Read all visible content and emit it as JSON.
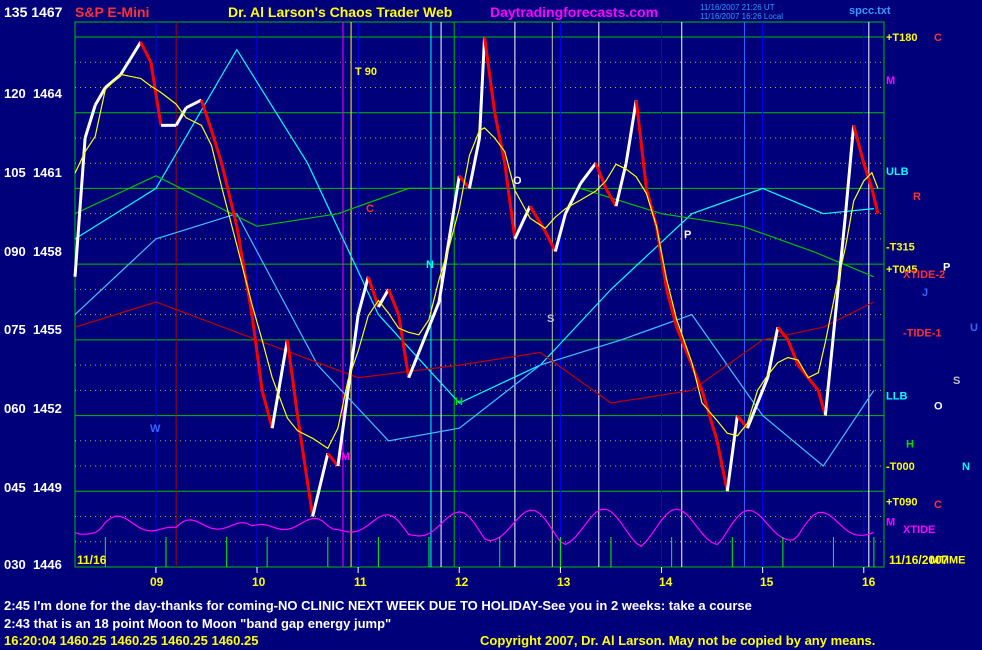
{
  "header": {
    "instrument": "S&P E-Mini",
    "title": "Dr. Al Larson's Chaos Trader Web",
    "site": "Daytradingforecasts.com",
    "time_utc": "11/16/2007 21:26 UT",
    "time_local": "11/16/2007 16:26 Local",
    "file": "spcc.txt"
  },
  "chart_data": {
    "type": "line",
    "title": "S&P E-Mini",
    "y_axis": {
      "ticks": [
        {
          "left": "135",
          "right": "1467",
          "price": 1467
        },
        {
          "left": "120",
          "right": "1464",
          "price": 1464
        },
        {
          "left": "105",
          "right": "1461",
          "price": 1461
        },
        {
          "left": "090",
          "right": "1458",
          "price": 1458
        },
        {
          "left": "075",
          "right": "1455",
          "price": 1455
        },
        {
          "left": "060",
          "right": "1452",
          "price": 1452
        },
        {
          "left": "045",
          "right": "1449",
          "price": 1449
        },
        {
          "left": "030",
          "right": "1446",
          "price": 1446
        }
      ],
      "ylim": [
        1446,
        1467.8
      ]
    },
    "x_axis": {
      "ticks": [
        "09",
        "10",
        "11",
        "12",
        "13",
        "14",
        "15",
        "16"
      ],
      "start_label": "11/16",
      "end_label": "11/16/2007"
    },
    "price_path": [
      [
        8.2,
        1457.5
      ],
      [
        8.3,
        1463
      ],
      [
        8.4,
        1464.3
      ],
      [
        8.5,
        1465
      ],
      [
        8.65,
        1465.5
      ],
      [
        8.85,
        1466.8
      ],
      [
        8.95,
        1466
      ],
      [
        9.05,
        1463.5
      ],
      [
        9.2,
        1463.5
      ],
      [
        9.3,
        1464.2
      ],
      [
        9.45,
        1464.5
      ],
      [
        9.55,
        1463.3
      ],
      [
        9.65,
        1462
      ],
      [
        9.8,
        1459.5
      ],
      [
        9.95,
        1456
      ],
      [
        10.05,
        1453
      ],
      [
        10.15,
        1451.5
      ],
      [
        10.3,
        1455
      ],
      [
        10.4,
        1452
      ],
      [
        10.55,
        1448
      ],
      [
        10.7,
        1450.5
      ],
      [
        10.8,
        1450
      ],
      [
        10.9,
        1453
      ],
      [
        11.0,
        1456
      ],
      [
        11.1,
        1457.5
      ],
      [
        11.2,
        1456.3
      ],
      [
        11.3,
        1457
      ],
      [
        11.4,
        1456
      ],
      [
        11.5,
        1453.5
      ],
      [
        11.6,
        1454.5
      ],
      [
        11.7,
        1455.5
      ],
      [
        11.8,
        1456.5
      ],
      [
        11.9,
        1459
      ],
      [
        12.0,
        1461.5
      ],
      [
        12.1,
        1461
      ],
      [
        12.2,
        1463
      ],
      [
        12.25,
        1467
      ],
      [
        12.35,
        1464
      ],
      [
        12.45,
        1462
      ],
      [
        12.55,
        1459
      ],
      [
        12.7,
        1460.3
      ],
      [
        12.85,
        1459.3
      ],
      [
        12.95,
        1458.5
      ],
      [
        13.05,
        1460
      ],
      [
        13.2,
        1461.2
      ],
      [
        13.35,
        1462
      ],
      [
        13.45,
        1461
      ],
      [
        13.55,
        1460.3
      ],
      [
        13.65,
        1462
      ],
      [
        13.75,
        1464.5
      ],
      [
        13.85,
        1461
      ],
      [
        13.95,
        1459.5
      ],
      [
        14.05,
        1457
      ],
      [
        14.15,
        1455.5
      ],
      [
        14.3,
        1454
      ],
      [
        14.4,
        1453
      ],
      [
        14.55,
        1451
      ],
      [
        14.65,
        1449
      ],
      [
        14.75,
        1452
      ],
      [
        14.85,
        1451.5
      ],
      [
        14.95,
        1452.5
      ],
      [
        15.05,
        1453.5
      ],
      [
        15.15,
        1455.5
      ],
      [
        15.25,
        1455
      ],
      [
        15.35,
        1454
      ],
      [
        15.45,
        1453.5
      ],
      [
        15.55,
        1453
      ],
      [
        15.62,
        1452
      ],
      [
        15.72,
        1456
      ],
      [
        15.82,
        1460
      ],
      [
        15.9,
        1463.5
      ],
      [
        16.0,
        1462
      ],
      [
        16.08,
        1461
      ],
      [
        16.14,
        1460
      ]
    ],
    "annotations": [
      "T 90",
      "C",
      "M",
      "H",
      "O",
      "S",
      "N",
      "P",
      "W"
    ],
    "right_labels": [
      {
        "text": "+T180",
        "price": 1467
      },
      {
        "text": "C",
        "price": 1467
      },
      {
        "text": "M",
        "price": 1465.3
      },
      {
        "text": "ULB",
        "price": 1461.7
      },
      {
        "text": "R",
        "price": 1460.7
      },
      {
        "text": "-T315",
        "price": 1458.7
      },
      {
        "text": "+T045",
        "price": 1457.8
      },
      {
        "text": "XTIDE-2",
        "price": 1457.6
      },
      {
        "text": "P",
        "price": 1457.9
      },
      {
        "text": "J",
        "price": 1456.9
      },
      {
        "text": "U",
        "price": 1455.5
      },
      {
        "text": "-TIDE-1",
        "price": 1455.3
      },
      {
        "text": "S",
        "price": 1453.4
      },
      {
        "text": "LLB",
        "price": 1452.8
      },
      {
        "text": "O",
        "price": 1452.4
      },
      {
        "text": "H",
        "price": 1450.9
      },
      {
        "text": "-T000",
        "price": 1450
      },
      {
        "text": "N",
        "price": 1450
      },
      {
        "text": "+T090",
        "price": 1448.6
      },
      {
        "text": "C",
        "price": 1448.5
      },
      {
        "text": "M",
        "price": 1447.8
      },
      {
        "text": "XTIDE",
        "price": 1447.5
      },
      {
        "text": "MTIME",
        "price": 1446.3
      }
    ]
  },
  "bottom_lines": [
    "2:45 I'm done for the day-thanks for coming-NO CLINIC NEXT WEEK DUE TO HOLIDAY-See you in 2 weeks: take a course",
    "2:43 that is an 18 point Moon to Moon \"band gap energy jump\"",
    "16:20:04  1460.25  1460.25  1460.25  1460.25"
  ],
  "copyright": "Copyright 2007, Dr. Al Larson. May not be copied by any means.",
  "colors": {
    "background": "#00007a",
    "price_up": "#ffffff",
    "price_down": "#ff0000",
    "grid_green": "#00c000",
    "cyan": "#00ffff",
    "magenta": "#ff00ff",
    "yellow": "#ffff00"
  }
}
